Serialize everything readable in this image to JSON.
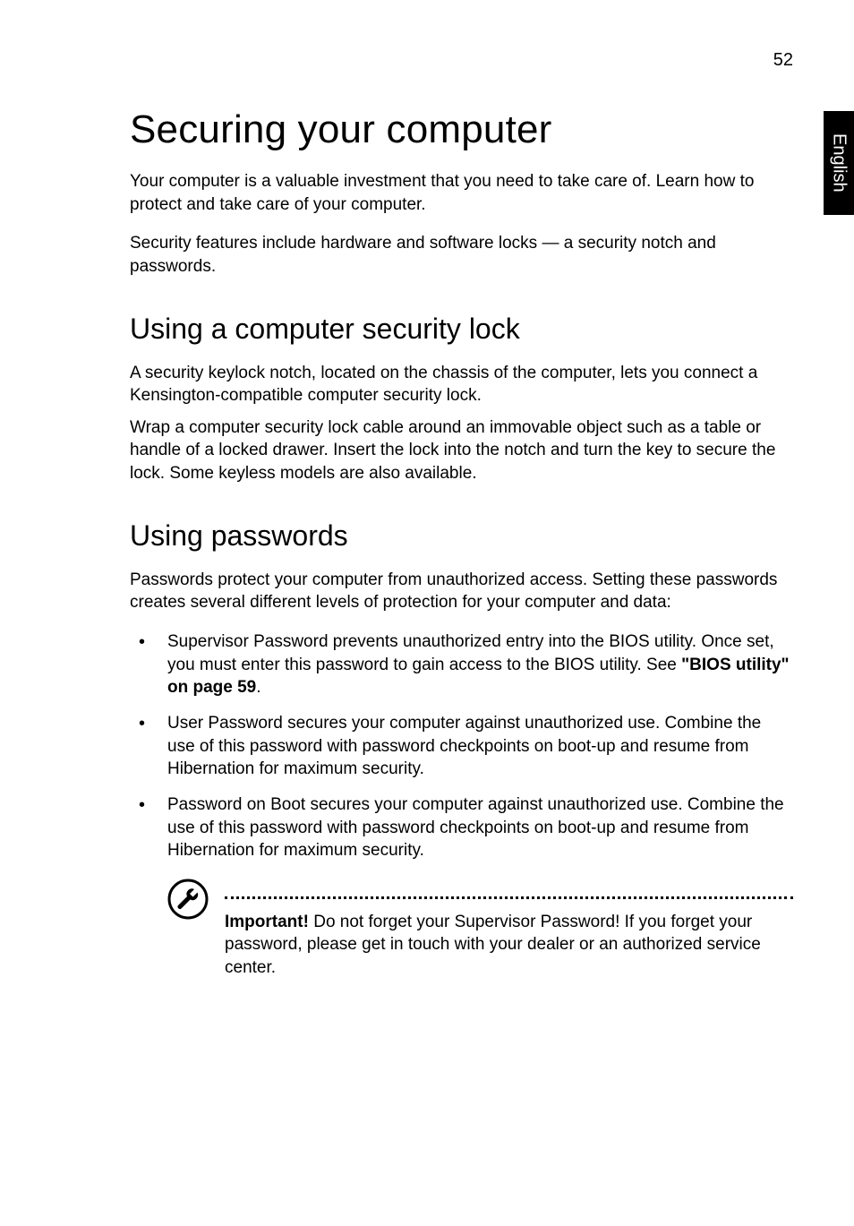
{
  "page_number": "52",
  "side_tab": "English",
  "h1": "Securing your computer",
  "intro_p1": "Your computer is a valuable investment that you need to take care of. Learn how to protect and take care of your computer.",
  "intro_p2": "Security features include hardware and software locks — a security notch and passwords.",
  "h2_lock": "Using a computer security lock",
  "lock_p1": "A security keylock notch, located on the chassis of the computer, lets you connect a Kensington-compatible computer security lock.",
  "lock_p2": "Wrap a computer security lock cable around an immovable object such as a table or handle of a locked drawer. Insert the lock into the notch and turn the key to secure the lock. Some keyless models are also available.",
  "h2_pw": "Using passwords",
  "pw_intro": "Passwords protect your computer from unauthorized access. Setting these passwords creates several different levels of protection for your computer and data:",
  "bullets": {
    "b1_pre": "Supervisor Password prevents unauthorized entry into the BIOS utility. Once set, you must enter this password to gain access to the BIOS utility. See ",
    "b1_bold": "\"BIOS utility\" on page 59",
    "b1_post": ".",
    "b2": "User Password secures your computer against unauthorized use. Combine the use of this password with password checkpoints on boot-up and resume from Hibernation for maximum security.",
    "b3": "Password on Boot secures your computer against unauthorized use. Combine the use of this password with password checkpoints on boot-up and resume from Hibernation for maximum security."
  },
  "note": {
    "bold": "Important!",
    "text": " Do not forget your Supervisor Password! If you forget your password, please get in touch with your dealer or an authorized service center."
  }
}
